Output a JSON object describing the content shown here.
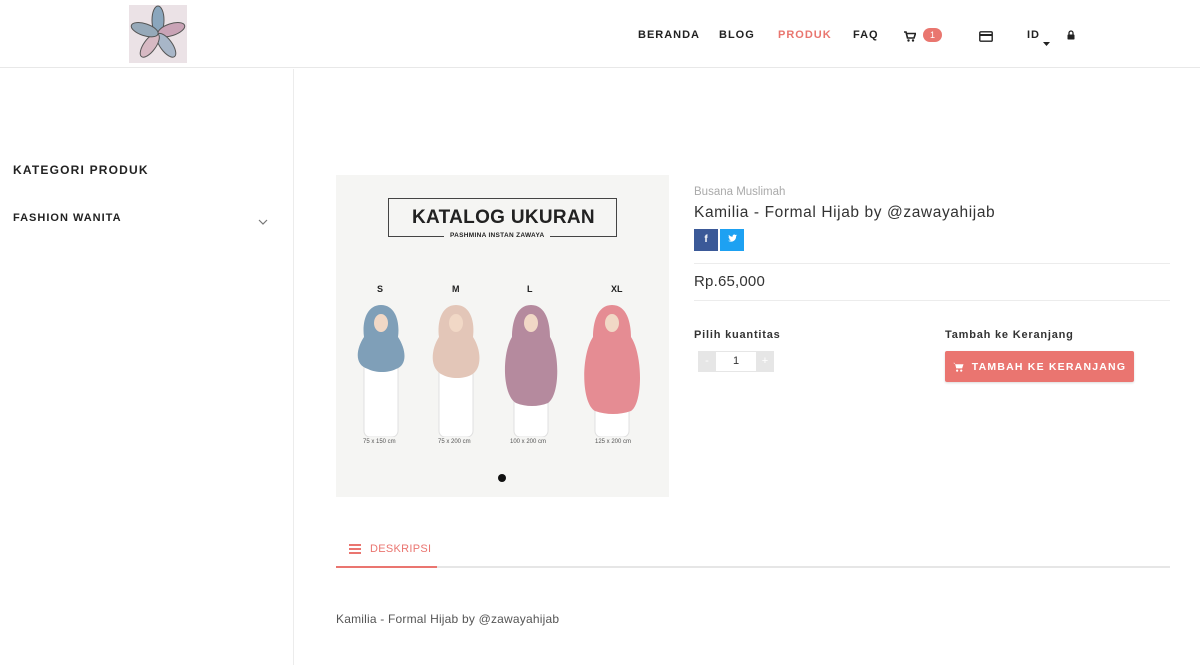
{
  "header": {
    "nav": [
      "BERANDA",
      "BLOG",
      "PRODUK",
      "FAQ"
    ],
    "active": "PRODUK",
    "cart_count": "1",
    "lang": "ID"
  },
  "sidebar": {
    "title": "KATEGORI PRODUK",
    "items": [
      {
        "label": "FASHION WANITA"
      }
    ]
  },
  "product_image": {
    "title": "KATALOG UKURAN",
    "subtitle": "PASHMINA INSTAN ZAWAYA",
    "sizes": [
      {
        "size": "S",
        "dim": "75 x 150 cm",
        "color": "#7f9fb8"
      },
      {
        "size": "M",
        "dim": "75 x 200 cm",
        "color": "#e3c6b8"
      },
      {
        "size": "L",
        "dim": "100 x 200 cm",
        "color": "#b58a9e"
      },
      {
        "size": "XL",
        "dim": "125 x 200 cm",
        "color": "#e58c93"
      }
    ]
  },
  "product": {
    "category": "Busana Muslimah",
    "title": "Kamilia - Formal Hijab by @zawayahijab",
    "price": "Rp.65,000",
    "qty_label": "Pilih kuantitas",
    "qty_minus": "-",
    "qty_value": "1",
    "qty_plus": "+",
    "cart_label": "Tambah ke Keranjang",
    "add_button": "TAMBAH KE KERANJANG",
    "share": {
      "facebook": "f",
      "twitter": "t"
    }
  },
  "tabs": [
    {
      "label": "DESKRIPSI"
    }
  ],
  "description": "Kamilia - Formal Hijab by @zawayahijab",
  "colors": {
    "accent": "#ea7570",
    "facebook": "#3b5998",
    "twitter": "#1da1f2"
  }
}
